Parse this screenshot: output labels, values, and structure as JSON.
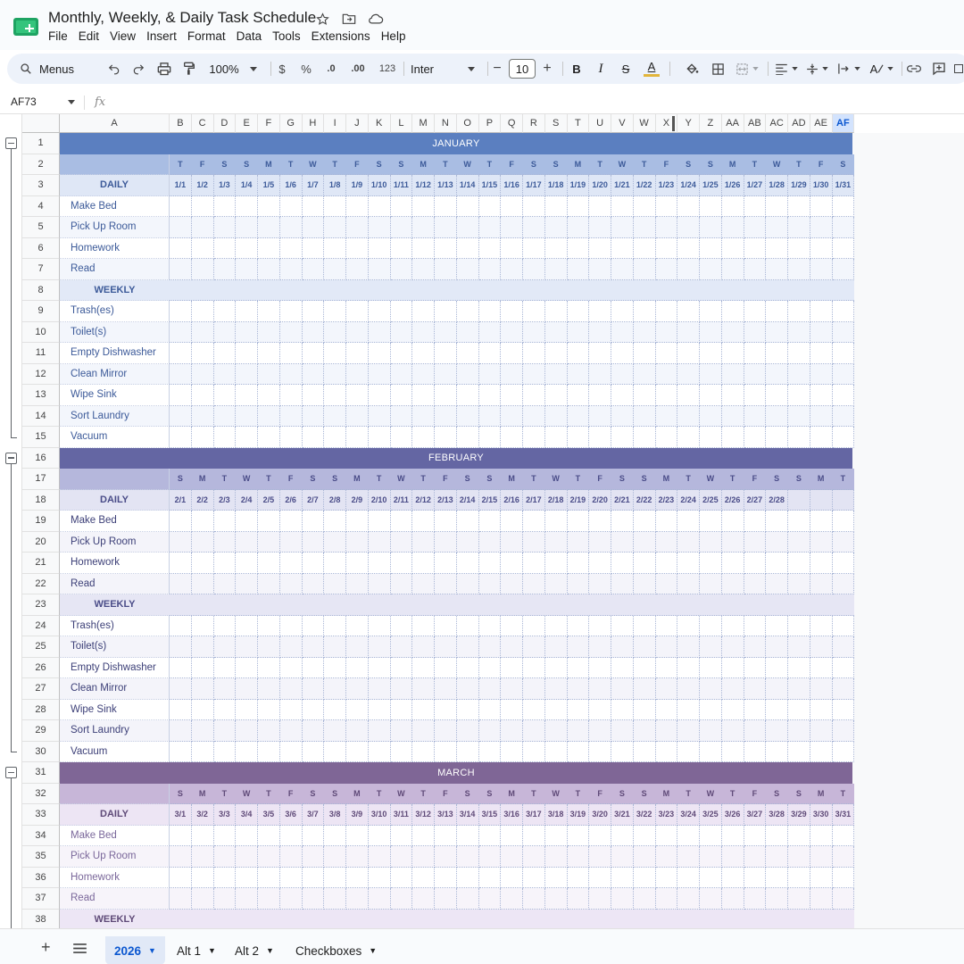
{
  "app": {
    "title": "Monthly, Weekly, & Daily Task Schedule",
    "menus": [
      "File",
      "Edit",
      "View",
      "Insert",
      "Format",
      "Data",
      "Tools",
      "Extensions",
      "Help"
    ]
  },
  "toolbar": {
    "search_label": "Menus",
    "zoom": "100%",
    "currency": "$",
    "percent": "%",
    "dec_decrease": ".0",
    "dec_increase": ".00",
    "number_format": "123",
    "font": "Inter",
    "font_size": "10",
    "bold": "B",
    "italic": "I",
    "strike": "S",
    "text_color": "A",
    "font_color_a": "A"
  },
  "formula_bar": {
    "name_box": "AF73",
    "fx": "fx"
  },
  "columns": [
    "A",
    "B",
    "C",
    "D",
    "E",
    "F",
    "G",
    "H",
    "I",
    "J",
    "K",
    "L",
    "M",
    "N",
    "O",
    "P",
    "Q",
    "R",
    "S",
    "T",
    "U",
    "V",
    "W",
    "X",
    "Y",
    "Z",
    "AA",
    "AB",
    "AC",
    "AD",
    "AE",
    "AF"
  ],
  "selected_column": "AF",
  "selected_column_label": "AF",
  "rows": [
    "1",
    "2",
    "3",
    "4",
    "5",
    "6",
    "7",
    "8",
    "9",
    "10",
    "11",
    "12",
    "13",
    "14",
    "15",
    "16",
    "17",
    "18",
    "19",
    "20",
    "21",
    "22",
    "23",
    "24",
    "25",
    "26",
    "27",
    "28",
    "29",
    "30",
    "31",
    "32",
    "33",
    "34",
    "35",
    "36",
    "37",
    "38"
  ],
  "section_labels": {
    "daily": "DAILY",
    "weekly": "WEEKLY"
  },
  "daily_tasks": [
    "Make Bed",
    "Pick Up Room",
    "Homework",
    "Read"
  ],
  "weekly_tasks": [
    "Trash(es)",
    "Toilet(s)",
    "Empty Dishwasher",
    "Clean Mirror",
    "Wipe Sink",
    "Sort Laundry",
    "Vacuum"
  ],
  "months": [
    {
      "name": "JANUARY",
      "days": [
        "T",
        "F",
        "S",
        "S",
        "M",
        "T",
        "W",
        "T",
        "F",
        "S",
        "S",
        "M",
        "T",
        "W",
        "T",
        "F",
        "S",
        "S",
        "M",
        "T",
        "W",
        "T",
        "F",
        "S",
        "S",
        "M",
        "T",
        "W",
        "T",
        "F",
        "S"
      ],
      "dates": [
        "1/1",
        "1/2",
        "1/3",
        "1/4",
        "1/5",
        "1/6",
        "1/7",
        "1/8",
        "1/9",
        "1/10",
        "1/11",
        "1/12",
        "1/13",
        "1/14",
        "1/15",
        "1/16",
        "1/17",
        "1/18",
        "1/19",
        "1/20",
        "1/21",
        "1/22",
        "1/23",
        "1/24",
        "1/25",
        "1/26",
        "1/27",
        "1/28",
        "1/29",
        "1/30",
        "1/31"
      ],
      "colors": {
        "band": "#5b7fc0",
        "day_row": "#a9bde3",
        "day_text": "#3c5a99",
        "label_text": "#3c5a99",
        "date_row": "#dfe7f6",
        "alt_row": "#f3f6fc",
        "section_row": "#e2e9f7"
      }
    },
    {
      "name": "FEBRUARY",
      "days": [
        "S",
        "M",
        "T",
        "W",
        "T",
        "F",
        "S",
        "S",
        "M",
        "T",
        "W",
        "T",
        "F",
        "S",
        "S",
        "M",
        "T",
        "W",
        "T",
        "F",
        "S",
        "S",
        "M",
        "T",
        "W",
        "T",
        "F",
        "S",
        "S",
        "M",
        "T"
      ],
      "dates": [
        "2/1",
        "2/2",
        "2/3",
        "2/4",
        "2/5",
        "2/6",
        "2/7",
        "2/8",
        "2/9",
        "2/10",
        "2/11",
        "2/12",
        "2/13",
        "2/14",
        "2/15",
        "2/16",
        "2/17",
        "2/18",
        "2/19",
        "2/20",
        "2/21",
        "2/22",
        "2/23",
        "2/24",
        "2/25",
        "2/26",
        "2/27",
        "2/28",
        "",
        "",
        ""
      ],
      "colors": {
        "band": "#6466a3",
        "day_row": "#b5b7dc",
        "day_text": "#4a4c88",
        "label_text": "#3d4078",
        "date_row": "#e3e4f3",
        "alt_row": "#f4f4fa",
        "section_row": "#e6e6f4"
      }
    },
    {
      "name": "MARCH",
      "days": [
        "S",
        "M",
        "T",
        "W",
        "T",
        "F",
        "S",
        "S",
        "M",
        "T",
        "W",
        "T",
        "F",
        "S",
        "S",
        "M",
        "T",
        "W",
        "T",
        "F",
        "S",
        "S",
        "M",
        "T",
        "W",
        "T",
        "F",
        "S",
        "S",
        "M",
        "T"
      ],
      "dates": [
        "3/1",
        "3/2",
        "3/3",
        "3/4",
        "3/5",
        "3/6",
        "3/7",
        "3/8",
        "3/9",
        "3/10",
        "3/11",
        "3/12",
        "3/13",
        "3/14",
        "3/15",
        "3/16",
        "3/17",
        "3/18",
        "3/19",
        "3/20",
        "3/21",
        "3/22",
        "3/23",
        "3/24",
        "3/25",
        "3/26",
        "3/27",
        "3/28",
        "3/29",
        "3/30",
        "3/31"
      ],
      "colors": {
        "band": "#7f6696",
        "day_row": "#c7b6d8",
        "day_text": "#5f4a78",
        "label_text": "#7a679a",
        "date_row": "#ede5f4",
        "alt_row": "#f7f4fa",
        "section_row": "#ede6f5"
      }
    }
  ],
  "sheets": [
    {
      "name": "2026",
      "active": true
    },
    {
      "name": "Alt 1",
      "active": false
    },
    {
      "name": "Alt 2",
      "active": false
    },
    {
      "name": "Checkboxes",
      "active": false
    }
  ]
}
